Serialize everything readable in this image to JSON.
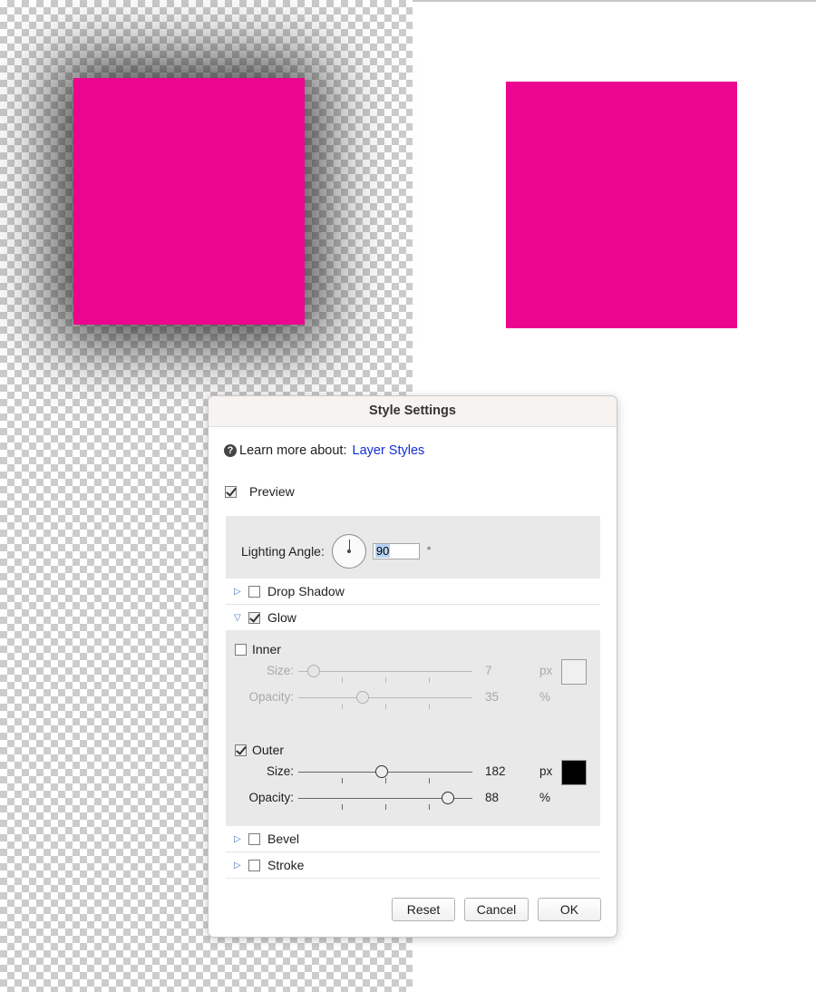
{
  "canvas": {
    "shape_color": "#ec058f",
    "transparent_bg": "checkerboard",
    "right_bg": "#ffffff"
  },
  "dialog": {
    "title": "Style Settings",
    "learn_more": {
      "icon": "help-icon",
      "icon_glyph": "?",
      "label": "Learn more about:",
      "link": "Layer Styles"
    },
    "preview": {
      "label": "Preview",
      "checked": true
    },
    "lighting_angle": {
      "label": "Lighting Angle:",
      "value": "90",
      "unit": "°"
    },
    "sections": {
      "drop_shadow": {
        "label": "Drop Shadow",
        "checked": false,
        "expanded": false
      },
      "glow": {
        "label": "Glow",
        "checked": true,
        "expanded": true
      },
      "bevel": {
        "label": "Bevel",
        "checked": false,
        "expanded": false
      },
      "stroke": {
        "label": "Stroke",
        "checked": false,
        "expanded": false
      }
    },
    "glow": {
      "inner": {
        "label": "Inner",
        "checked": false,
        "enabled": false,
        "size": {
          "label": "Size:",
          "value": "7",
          "unit": "px",
          "level": 0.09
        },
        "opacity": {
          "label": "Opacity:",
          "value": "35",
          "unit": "%",
          "level": 0.37
        },
        "color": "#f0f0f0"
      },
      "outer": {
        "label": "Outer",
        "checked": true,
        "enabled": true,
        "size": {
          "label": "Size:",
          "value": "182",
          "unit": "px",
          "level": 0.48
        },
        "opacity": {
          "label": "Opacity:",
          "value": "88",
          "unit": "%",
          "level": 0.86
        },
        "color": "#000000"
      }
    },
    "buttons": {
      "reset": "Reset",
      "cancel": "Cancel",
      "ok": "OK"
    }
  }
}
